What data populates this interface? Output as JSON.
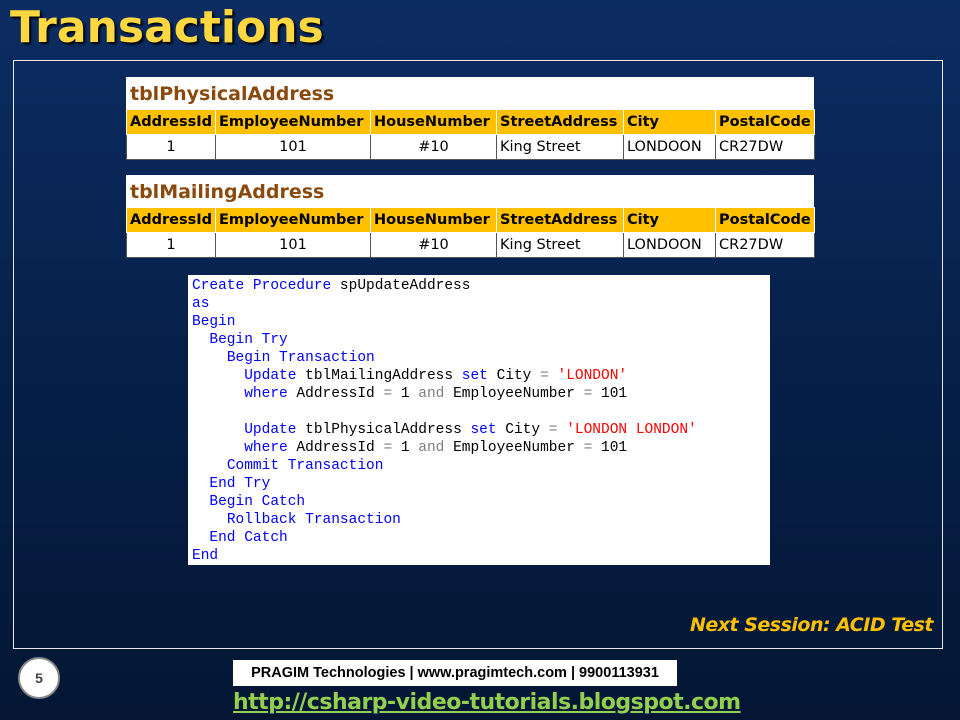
{
  "slide": {
    "title": "Transactions",
    "next_session": "Next Session: ACID Test",
    "page_number": "5"
  },
  "tables": [
    {
      "name": "tblPhysicalAddress",
      "headers": [
        "AddressId",
        "EmployeeNumber",
        "HouseNumber",
        "StreetAddress",
        "City",
        "PostalCode"
      ],
      "row": [
        "1",
        "101",
        "#10",
        "King Street",
        "LONDOON",
        "CR27DW"
      ]
    },
    {
      "name": "tblMailingAddress",
      "headers": [
        "AddressId",
        "EmployeeNumber",
        "HouseNumber",
        "StreetAddress",
        "City",
        "PostalCode"
      ],
      "row": [
        "1",
        "101",
        "#10",
        "King Street",
        "LONDOON",
        "CR27DW"
      ]
    }
  ],
  "code": {
    "lines": [
      [
        {
          "t": "Create Procedure",
          "k": "kw"
        },
        {
          "t": " spUpdateAddress",
          "k": ""
        }
      ],
      [
        {
          "t": "as",
          "k": "kw"
        }
      ],
      [
        {
          "t": "Begin",
          "k": "kw"
        }
      ],
      [
        {
          "t": "  ",
          "k": ""
        },
        {
          "t": "Begin Try",
          "k": "kw"
        }
      ],
      [
        {
          "t": "    ",
          "k": ""
        },
        {
          "t": "Begin Transaction",
          "k": "kw"
        }
      ],
      [
        {
          "t": "      ",
          "k": ""
        },
        {
          "t": "Update",
          "k": "kw"
        },
        {
          "t": " tblMailingAddress ",
          "k": ""
        },
        {
          "t": "set",
          "k": "kw"
        },
        {
          "t": " City ",
          "k": ""
        },
        {
          "t": "=",
          "k": "op"
        },
        {
          "t": " ",
          "k": ""
        },
        {
          "t": "'LONDON'",
          "k": "str"
        }
      ],
      [
        {
          "t": "      ",
          "k": ""
        },
        {
          "t": "where",
          "k": "kw"
        },
        {
          "t": " AddressId ",
          "k": ""
        },
        {
          "t": "=",
          "k": "op"
        },
        {
          "t": " 1 ",
          "k": ""
        },
        {
          "t": "and",
          "k": "op"
        },
        {
          "t": " EmployeeNumber ",
          "k": ""
        },
        {
          "t": "=",
          "k": "op"
        },
        {
          "t": " 101",
          "k": ""
        }
      ],
      [],
      [
        {
          "t": "      ",
          "k": ""
        },
        {
          "t": "Update",
          "k": "kw"
        },
        {
          "t": " tblPhysicalAddress ",
          "k": ""
        },
        {
          "t": "set",
          "k": "kw"
        },
        {
          "t": " City ",
          "k": ""
        },
        {
          "t": "=",
          "k": "op"
        },
        {
          "t": " ",
          "k": ""
        },
        {
          "t": "'LONDON LONDON'",
          "k": "str"
        }
      ],
      [
        {
          "t": "      ",
          "k": ""
        },
        {
          "t": "where",
          "k": "kw"
        },
        {
          "t": " AddressId ",
          "k": ""
        },
        {
          "t": "=",
          "k": "op"
        },
        {
          "t": " 1 ",
          "k": ""
        },
        {
          "t": "and",
          "k": "op"
        },
        {
          "t": " EmployeeNumber ",
          "k": ""
        },
        {
          "t": "=",
          "k": "op"
        },
        {
          "t": " 101",
          "k": ""
        }
      ],
      [
        {
          "t": "    ",
          "k": ""
        },
        {
          "t": "Commit Transaction",
          "k": "kw"
        }
      ],
      [
        {
          "t": "  ",
          "k": ""
        },
        {
          "t": "End Try",
          "k": "kw"
        }
      ],
      [
        {
          "t": "  ",
          "k": ""
        },
        {
          "t": "Begin Catch",
          "k": "kw"
        }
      ],
      [
        {
          "t": "    ",
          "k": ""
        },
        {
          "t": "Rollback Transaction",
          "k": "kw"
        }
      ],
      [
        {
          "t": "  ",
          "k": ""
        },
        {
          "t": "End Catch",
          "k": "kw"
        }
      ],
      [
        {
          "t": "End",
          "k": "kw"
        }
      ]
    ]
  },
  "footer": {
    "brand": "PRAGIM Technologies | www.pragimtech.com | 9900113931",
    "link": "http://csharp-video-tutorials.blogspot.com"
  },
  "colors": {
    "title": "#ffd740",
    "header_fill": "#ffc000",
    "table_name": "#8a4a0e",
    "keyword": "#0000ff",
    "string": "#ff0000",
    "link": "#92d050"
  }
}
